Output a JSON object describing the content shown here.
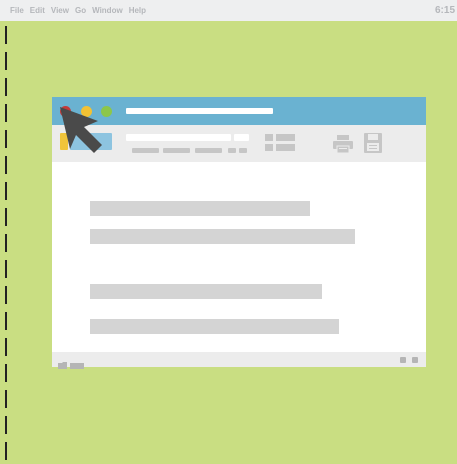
{
  "menubar": {
    "items": [
      "File",
      "Edit",
      "View",
      "Go",
      "Window",
      "Help"
    ],
    "clock": "6:15"
  },
  "window": {
    "icons": {
      "print": "printer-icon",
      "save": "floppy-disk-icon",
      "view": "grid-view-icon",
      "folder": "folder-icon",
      "cursor": "mouse-pointer-icon"
    }
  },
  "colors": {
    "desktop": "#c9de82",
    "titlebar": "#6ab2d1",
    "close": "#c43a3a",
    "minimize": "#f2c233",
    "zoom": "#8cc64b",
    "toolbar": "#ececec",
    "placeholder_text": "#d4d4d4"
  }
}
